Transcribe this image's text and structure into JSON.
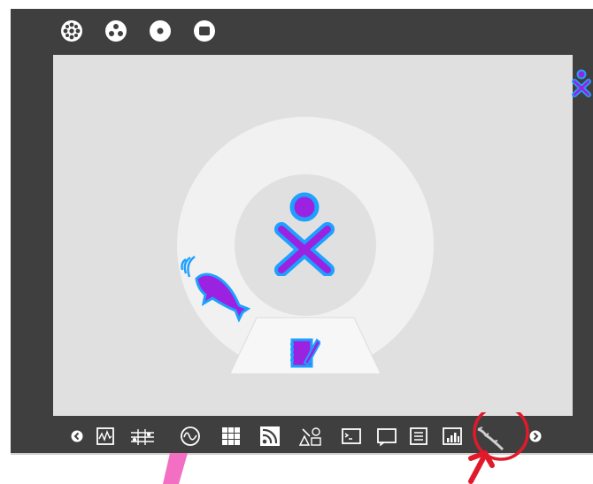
{
  "screen": {
    "colors": {
      "frame": "#3f3f3f",
      "canvas": "#e0e0e0",
      "ring": "#f1f1f1",
      "xo_stroke": "#1ea0ff",
      "xo_fill": "#9b22e0",
      "annotation": "#e11a2b",
      "pink_mark": "#f26fc4"
    }
  },
  "top_toolbar": {
    "views": [
      {
        "name": "neighborhood-view",
        "icon": "neighborhood-icon"
      },
      {
        "name": "group-view",
        "icon": "group-icon"
      },
      {
        "name": "home-view",
        "icon": "home-icon"
      },
      {
        "name": "activity-view",
        "icon": "activity-icon"
      }
    ]
  },
  "home": {
    "center_icon": "xo-buddy-icon",
    "ring_items": [
      {
        "name": "dolphin-activity",
        "icon": "dolphin-icon"
      },
      {
        "name": "write-activity",
        "icon": "write-icon"
      }
    ]
  },
  "frame_right": {
    "icon": "xo-buddy-small-icon"
  },
  "activity_toolbar": {
    "scroll_left": "chevron-left-icon",
    "scroll_right": "chevron-right-icon",
    "items": [
      "measure-icon",
      "tamtam-icon",
      "oscilloscope-icon",
      "memorize-icon",
      "rss-icon",
      "edit-paint-icon",
      "terminal-icon",
      "chat-icon",
      "list-icon",
      "analyze-icon",
      "map-activity-icon"
    ],
    "highlighted_item": "map-activity-icon"
  }
}
